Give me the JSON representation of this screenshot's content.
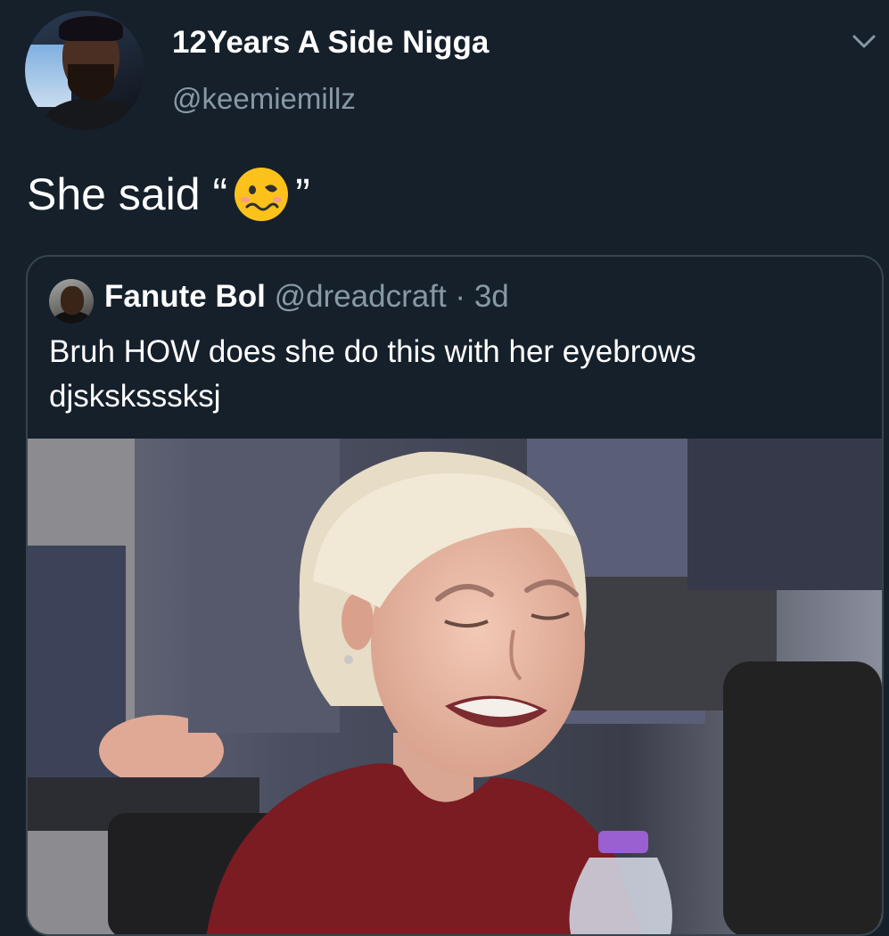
{
  "author": {
    "display_name": "12Years A Side Nigga",
    "handle": "@keemiemillz"
  },
  "tweet": {
    "text_before": "She said “",
    "emoji": "woozy-face-emoji",
    "text_after": "”"
  },
  "quoted": {
    "display_name": "Fanute Bol",
    "handle": "@dreadcraft",
    "separator": "·",
    "time": "3d",
    "text": "Bruh HOW does she do this with her eyebrows djsksksssksj"
  },
  "colors": {
    "background": "#15202b",
    "text": "#ffffff",
    "secondary": "#8899a6",
    "border": "#38444d"
  },
  "icons": {
    "menu": "chevron-down-icon"
  }
}
